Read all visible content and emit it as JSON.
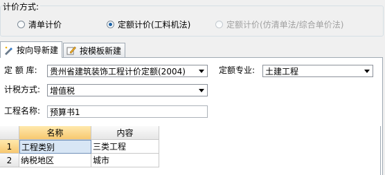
{
  "pricing_method": {
    "title": "计价方式:",
    "options": [
      {
        "label": "清单计价",
        "checked": false,
        "disabled": false
      },
      {
        "label": "定额计价(工料机法)",
        "checked": true,
        "disabled": false
      },
      {
        "label": "定额计价(仿清单法/综合单价法)",
        "checked": false,
        "disabled": true
      }
    ]
  },
  "tabs": [
    {
      "label": "按向导新建",
      "active": true,
      "icon": "wizard-icon"
    },
    {
      "label": "按模板新建",
      "active": false,
      "icon": "template-icon"
    }
  ],
  "form": {
    "quota_lib_label": "定 额 库:",
    "quota_lib_value": "贵州省建筑装饰工程计价定额(2004)",
    "quota_major_label": "定额专业:",
    "quota_major_value": "土建工程",
    "tax_method_label": "计税方式:",
    "tax_method_value": "增值税",
    "project_name_label": "工程名称:",
    "project_name_value": "预算书1"
  },
  "grid": {
    "headers": [
      "名称",
      "内容"
    ],
    "rows": [
      {
        "num": "1",
        "name": "工程类别",
        "content": "三类工程"
      },
      {
        "num": "2",
        "name": "纳税地区",
        "content": "城市"
      }
    ]
  },
  "colors": {
    "accent": "#1f63a6",
    "header_selected": "#f7c870",
    "cell_selected": "#d8e6f5"
  }
}
